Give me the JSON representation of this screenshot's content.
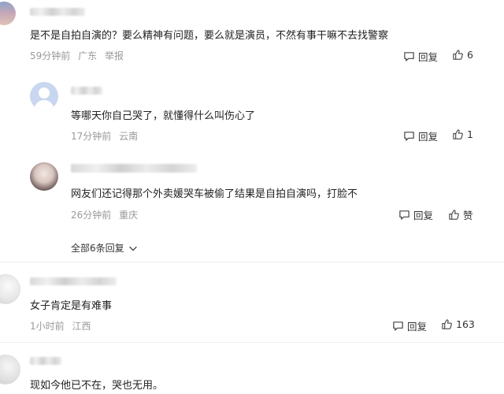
{
  "comments": [
    {
      "text": "是不是自拍自演的？要么精神有问题，要么就是演员，不然有事干嘛不去找警察",
      "time": "59分钟前",
      "location": "广东",
      "report": "举报",
      "reply_label": "回复",
      "like_count": "6"
    },
    {
      "text": "等哪天你自己哭了，就懂得什么叫伤心了",
      "time": "17分钟前",
      "location": "云南",
      "reply_label": "回复",
      "like_count": "1"
    },
    {
      "text": "网友们还记得那个外卖媛哭车被偷了结果是自拍自演吗，打脸不",
      "time": "26分钟前",
      "location": "重庆",
      "reply_label": "回复",
      "like_label": "赞"
    },
    {
      "text": "女子肯定是有难事",
      "time": "1小时前",
      "location": "江西",
      "reply_label": "回复",
      "like_count": "163"
    },
    {
      "text": "现如今他已不在，哭也无用。"
    }
  ],
  "replies_toggle": "全部6条回复",
  "icons": {
    "reply": "comment-bubble-icon",
    "like": "thumbs-up-icon",
    "expand": "chevron-down-icon"
  }
}
